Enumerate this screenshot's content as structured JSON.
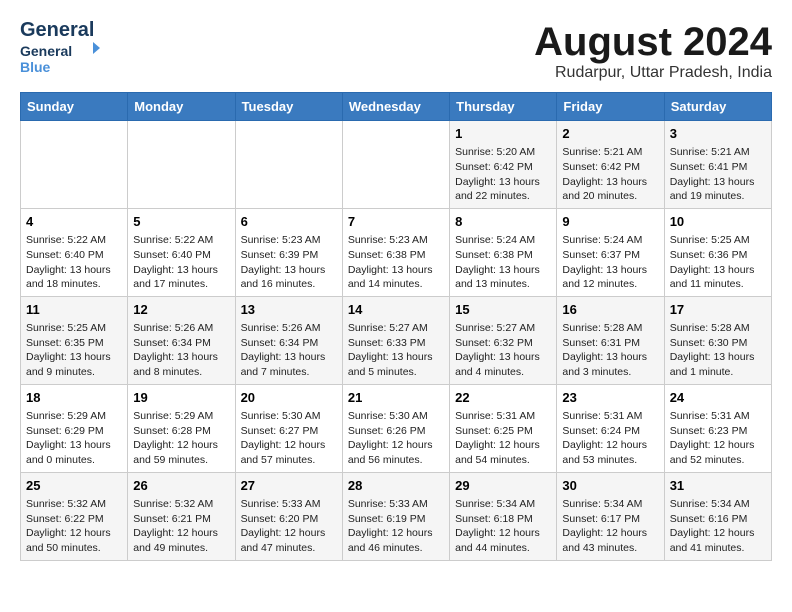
{
  "header": {
    "logo_general": "General",
    "logo_blue": "Blue",
    "month_year": "August 2024",
    "location": "Rudarpur, Uttar Pradesh, India"
  },
  "weekdays": [
    "Sunday",
    "Monday",
    "Tuesday",
    "Wednesday",
    "Thursday",
    "Friday",
    "Saturday"
  ],
  "weeks": [
    [
      {
        "day": "",
        "info": ""
      },
      {
        "day": "",
        "info": ""
      },
      {
        "day": "",
        "info": ""
      },
      {
        "day": "",
        "info": ""
      },
      {
        "day": "1",
        "info": "Sunrise: 5:20 AM\nSunset: 6:42 PM\nDaylight: 13 hours\nand 22 minutes."
      },
      {
        "day": "2",
        "info": "Sunrise: 5:21 AM\nSunset: 6:42 PM\nDaylight: 13 hours\nand 20 minutes."
      },
      {
        "day": "3",
        "info": "Sunrise: 5:21 AM\nSunset: 6:41 PM\nDaylight: 13 hours\nand 19 minutes."
      }
    ],
    [
      {
        "day": "4",
        "info": "Sunrise: 5:22 AM\nSunset: 6:40 PM\nDaylight: 13 hours\nand 18 minutes."
      },
      {
        "day": "5",
        "info": "Sunrise: 5:22 AM\nSunset: 6:40 PM\nDaylight: 13 hours\nand 17 minutes."
      },
      {
        "day": "6",
        "info": "Sunrise: 5:23 AM\nSunset: 6:39 PM\nDaylight: 13 hours\nand 16 minutes."
      },
      {
        "day": "7",
        "info": "Sunrise: 5:23 AM\nSunset: 6:38 PM\nDaylight: 13 hours\nand 14 minutes."
      },
      {
        "day": "8",
        "info": "Sunrise: 5:24 AM\nSunset: 6:38 PM\nDaylight: 13 hours\nand 13 minutes."
      },
      {
        "day": "9",
        "info": "Sunrise: 5:24 AM\nSunset: 6:37 PM\nDaylight: 13 hours\nand 12 minutes."
      },
      {
        "day": "10",
        "info": "Sunrise: 5:25 AM\nSunset: 6:36 PM\nDaylight: 13 hours\nand 11 minutes."
      }
    ],
    [
      {
        "day": "11",
        "info": "Sunrise: 5:25 AM\nSunset: 6:35 PM\nDaylight: 13 hours\nand 9 minutes."
      },
      {
        "day": "12",
        "info": "Sunrise: 5:26 AM\nSunset: 6:34 PM\nDaylight: 13 hours\nand 8 minutes."
      },
      {
        "day": "13",
        "info": "Sunrise: 5:26 AM\nSunset: 6:34 PM\nDaylight: 13 hours\nand 7 minutes."
      },
      {
        "day": "14",
        "info": "Sunrise: 5:27 AM\nSunset: 6:33 PM\nDaylight: 13 hours\nand 5 minutes."
      },
      {
        "day": "15",
        "info": "Sunrise: 5:27 AM\nSunset: 6:32 PM\nDaylight: 13 hours\nand 4 minutes."
      },
      {
        "day": "16",
        "info": "Sunrise: 5:28 AM\nSunset: 6:31 PM\nDaylight: 13 hours\nand 3 minutes."
      },
      {
        "day": "17",
        "info": "Sunrise: 5:28 AM\nSunset: 6:30 PM\nDaylight: 13 hours\nand 1 minute."
      }
    ],
    [
      {
        "day": "18",
        "info": "Sunrise: 5:29 AM\nSunset: 6:29 PM\nDaylight: 13 hours\nand 0 minutes."
      },
      {
        "day": "19",
        "info": "Sunrise: 5:29 AM\nSunset: 6:28 PM\nDaylight: 12 hours\nand 59 minutes."
      },
      {
        "day": "20",
        "info": "Sunrise: 5:30 AM\nSunset: 6:27 PM\nDaylight: 12 hours\nand 57 minutes."
      },
      {
        "day": "21",
        "info": "Sunrise: 5:30 AM\nSunset: 6:26 PM\nDaylight: 12 hours\nand 56 minutes."
      },
      {
        "day": "22",
        "info": "Sunrise: 5:31 AM\nSunset: 6:25 PM\nDaylight: 12 hours\nand 54 minutes."
      },
      {
        "day": "23",
        "info": "Sunrise: 5:31 AM\nSunset: 6:24 PM\nDaylight: 12 hours\nand 53 minutes."
      },
      {
        "day": "24",
        "info": "Sunrise: 5:31 AM\nSunset: 6:23 PM\nDaylight: 12 hours\nand 52 minutes."
      }
    ],
    [
      {
        "day": "25",
        "info": "Sunrise: 5:32 AM\nSunset: 6:22 PM\nDaylight: 12 hours\nand 50 minutes."
      },
      {
        "day": "26",
        "info": "Sunrise: 5:32 AM\nSunset: 6:21 PM\nDaylight: 12 hours\nand 49 minutes."
      },
      {
        "day": "27",
        "info": "Sunrise: 5:33 AM\nSunset: 6:20 PM\nDaylight: 12 hours\nand 47 minutes."
      },
      {
        "day": "28",
        "info": "Sunrise: 5:33 AM\nSunset: 6:19 PM\nDaylight: 12 hours\nand 46 minutes."
      },
      {
        "day": "29",
        "info": "Sunrise: 5:34 AM\nSunset: 6:18 PM\nDaylight: 12 hours\nand 44 minutes."
      },
      {
        "day": "30",
        "info": "Sunrise: 5:34 AM\nSunset: 6:17 PM\nDaylight: 12 hours\nand 43 minutes."
      },
      {
        "day": "31",
        "info": "Sunrise: 5:34 AM\nSunset: 6:16 PM\nDaylight: 12 hours\nand 41 minutes."
      }
    ]
  ]
}
